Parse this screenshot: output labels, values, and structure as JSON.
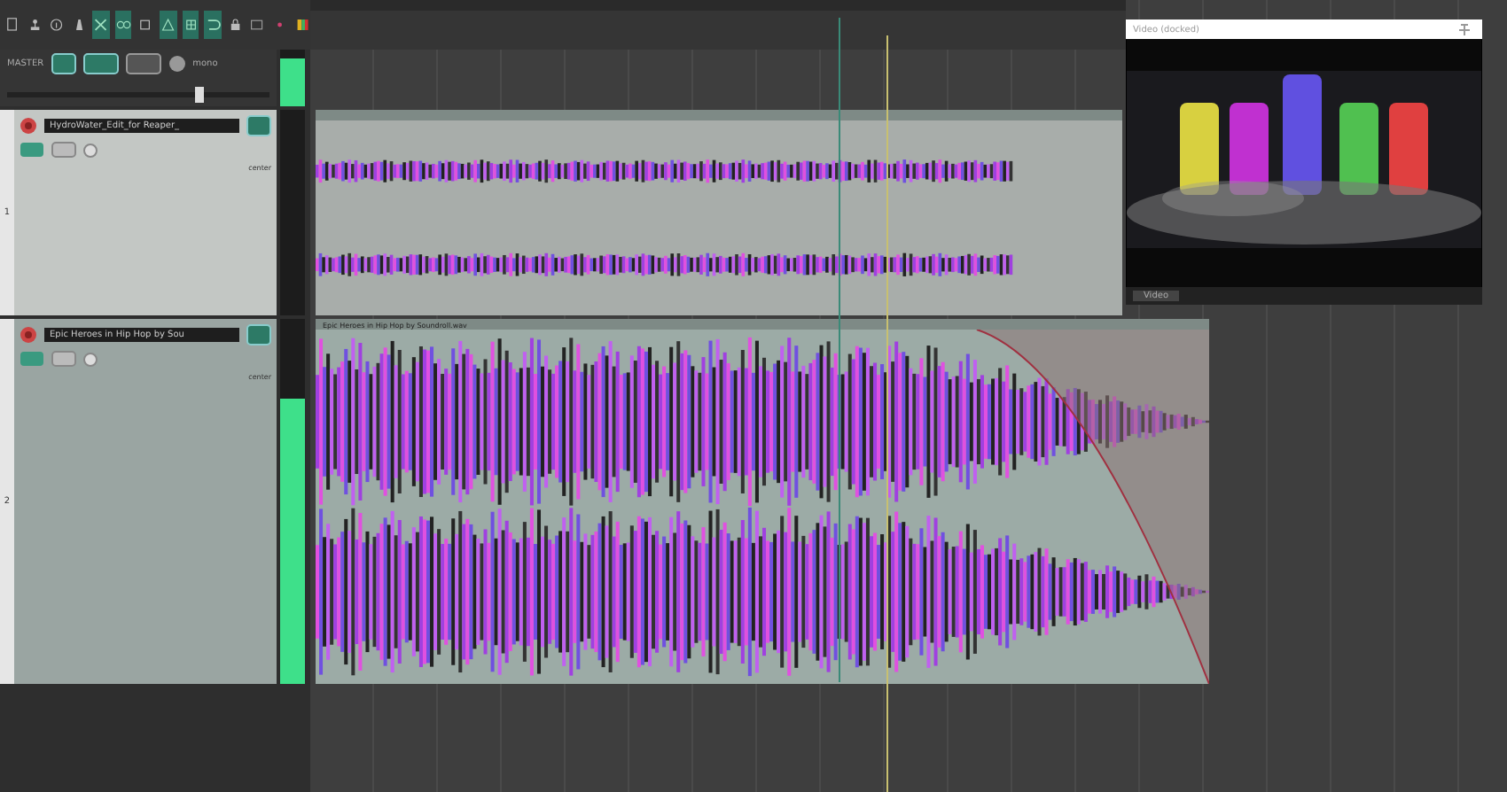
{
  "master": {
    "label": "MASTER",
    "mode": "mono",
    "level": 0.85,
    "volume": {
      "level": 0.73
    }
  },
  "tracks": [
    {
      "number": "1",
      "name": "HydroWater_Edit_for Reaper_",
      "pan": "center",
      "level": 0,
      "item": {
        "fade": false
      }
    },
    {
      "number": "2",
      "name": "Epic Heroes in Hip Hop by Sou",
      "pan": "center",
      "level": 0.78,
      "item": {
        "label": "Epic Heroes in Hip Hop by Soundroll.wav",
        "fade": true
      }
    }
  ],
  "video": {
    "title": "Video (docked)",
    "tab": "Video"
  }
}
